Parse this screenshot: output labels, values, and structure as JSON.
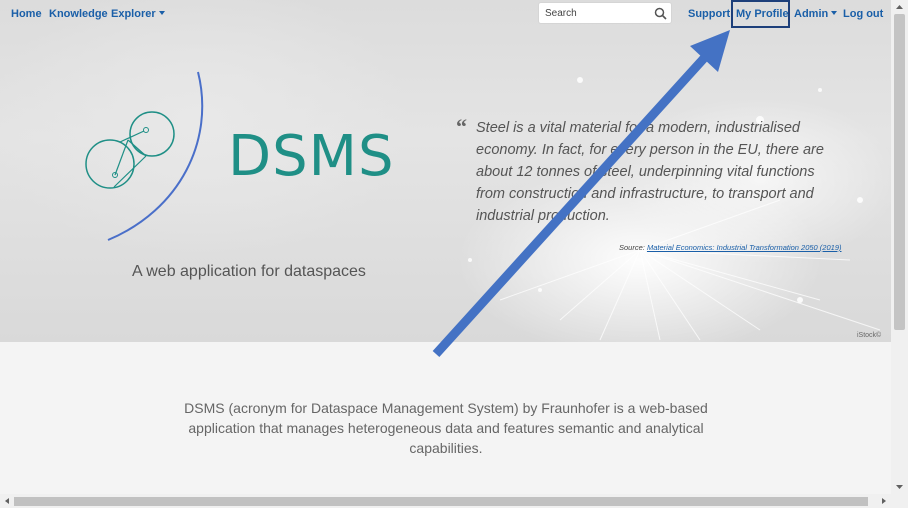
{
  "nav": {
    "home": "Home",
    "knowledge": "Knowledge",
    "explorer": "Explorer",
    "search_placeholder": "Search",
    "support": "Support",
    "my_profile": "My Profile",
    "admin": "Admin",
    "logout": "Log out"
  },
  "hero": {
    "logo_text": "DSMS",
    "tagline": "A web application for dataspaces",
    "quote": "Steel is a vital material for a modern, industrialised economy. In fact, for every person in the EU, there are about 12 tonnes of steel, underpinning vital functions from construction and infrastructure, to transport and industrial production.",
    "source_label": "Source:",
    "source_link": "Material Economics: Industrial Transformation 2050 (2019)",
    "image_credit": "iStock©"
  },
  "description": "DSMS (acronym for Dataspace Management System) by Fraunhofer is a web-based application that manages heterogeneous data and features semantic and analytical capabilities.",
  "colors": {
    "nav_link": "#1a5fa8",
    "logo_teal": "#1f8f86",
    "logo_arc": "#4a6fc9",
    "annotation_arrow": "#4472c4",
    "highlight_box": "#1d3f7a"
  },
  "icons": {
    "search": "search-icon",
    "quote": "quote-icon",
    "caret": "caret-down-icon"
  }
}
